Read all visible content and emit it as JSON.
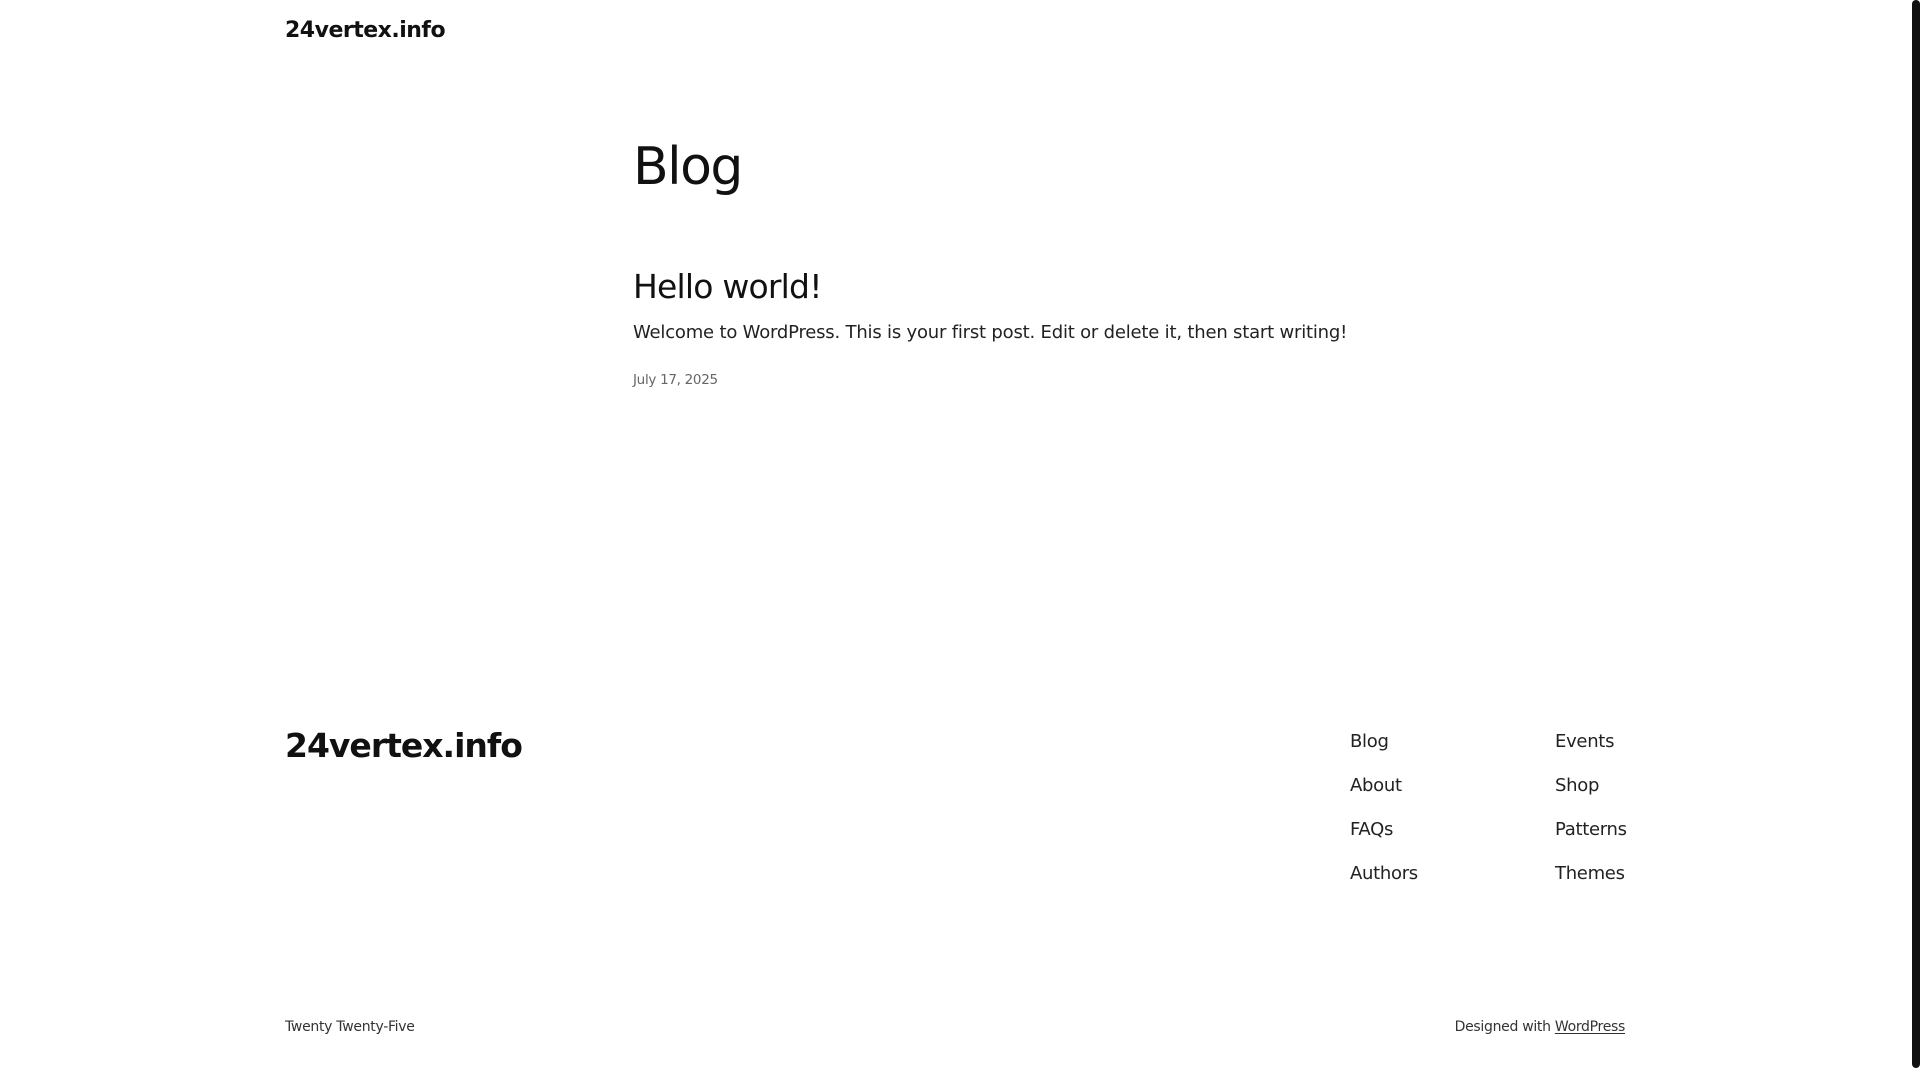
{
  "header": {
    "site_title": "24vertex.info"
  },
  "main": {
    "heading": "Blog",
    "posts": [
      {
        "title": "Hello world!",
        "excerpt": "Welcome to WordPress. This is your first post. Edit or delete it, then start writing!",
        "date": "July 17, 2025"
      }
    ]
  },
  "footer": {
    "site_title": "24vertex.info",
    "nav_col_1": [
      "Blog",
      "About",
      "FAQs",
      "Authors"
    ],
    "nav_col_2": [
      "Events",
      "Shop",
      "Patterns",
      "Themes"
    ],
    "theme_credit": "Twenty Twenty-Five",
    "designed_with": "Designed with",
    "wordpress_link": "WordPress"
  }
}
